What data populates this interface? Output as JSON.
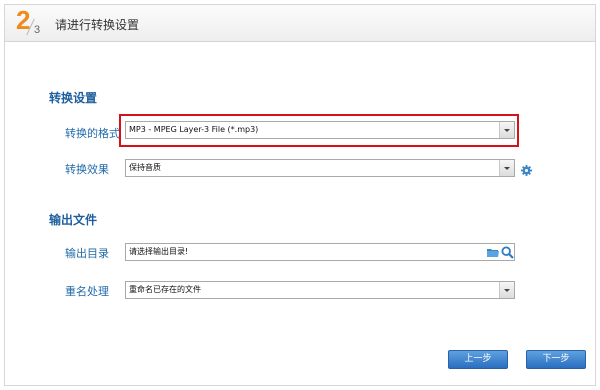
{
  "header": {
    "step_current": "2",
    "step_total": "3",
    "title": "请进行转换设置"
  },
  "conversion": {
    "section_title": "转换设置",
    "format": {
      "label": "转换的格式",
      "value": "MP3 - MPEG Layer-3 File (*.mp3)"
    },
    "effect": {
      "label": "转换效果",
      "value": "保持音质"
    }
  },
  "output": {
    "section_title": "输出文件",
    "directory": {
      "label": "输出目录",
      "value": "请选择输出目录!"
    },
    "rename": {
      "label": "重名处理",
      "value": "重命名已存在的文件"
    }
  },
  "footer": {
    "prev_label": "上一步",
    "next_label": "下一步"
  },
  "colors": {
    "step_accent": "#f08a1c",
    "section_title": "#1f5f9e",
    "highlight_border": "#d6111b",
    "button": "#2a6fc0"
  },
  "icons": {
    "effect_settings": "gear-icon",
    "browse_folder": "folder-icon",
    "search": "search-icon"
  }
}
